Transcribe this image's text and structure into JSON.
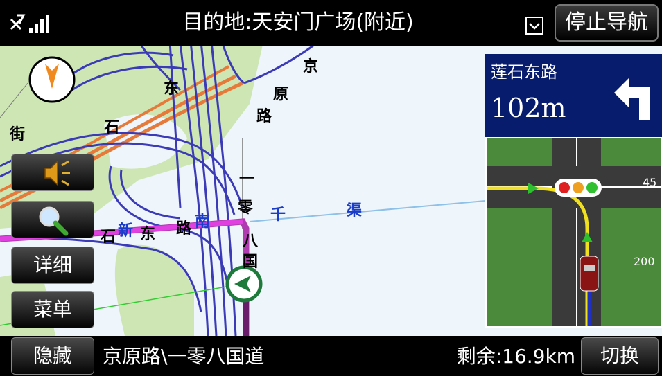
{
  "top_bar": {
    "destination": "目的地:天安门广场(附近)",
    "stop_navigation_label": "停止导航"
  },
  "map_labels": [
    {
      "text": "京",
      "color": "#000000"
    },
    {
      "text": "原",
      "color": "#000000"
    },
    {
      "text": "路",
      "color": "#000000"
    },
    {
      "text": "东",
      "color": "#000000"
    },
    {
      "text": "石",
      "color": "#000000"
    },
    {
      "text": "街",
      "color": "#000000"
    },
    {
      "text": "一",
      "color": "#000000"
    },
    {
      "text": "零",
      "color": "#000000"
    },
    {
      "text": "八",
      "color": "#000000"
    },
    {
      "text": "国",
      "color": "#000000"
    },
    {
      "text": "千",
      "color": "#1a3cc9"
    },
    {
      "text": "渠",
      "color": "#1a3cc9"
    },
    {
      "text": "石",
      "color": "#000000"
    },
    {
      "text": "新",
      "color": "#1a3cc9"
    },
    {
      "text": "东",
      "color": "#000000"
    },
    {
      "text": "路",
      "color": "#000000"
    },
    {
      "text": "南",
      "color": "#1a3cc9"
    }
  ],
  "left_buttons": {
    "volume_icon": "speaker-icon",
    "zoom_icon": "magnifier-icon",
    "details_label": "详细",
    "menu_label": "菜单"
  },
  "turn_panel": {
    "road_name": "莲石东路",
    "distance": "102m",
    "turn_icon": "turn-left-arrow-icon"
  },
  "junction_view": {
    "label_right_top": "45",
    "label_right_bottom": "200"
  },
  "bottom_bar": {
    "hide_label": "隐藏",
    "current_road": "京原路\\一零八国道",
    "remaining": "剩余:16.9km",
    "switch_label": "切换"
  },
  "colors": {
    "route": "#cc33cc",
    "road_blue": "#3b3bb8",
    "road_orange": "#e67a3a",
    "green_area": "#cde6b4",
    "panel_blue": "#081c6e"
  }
}
